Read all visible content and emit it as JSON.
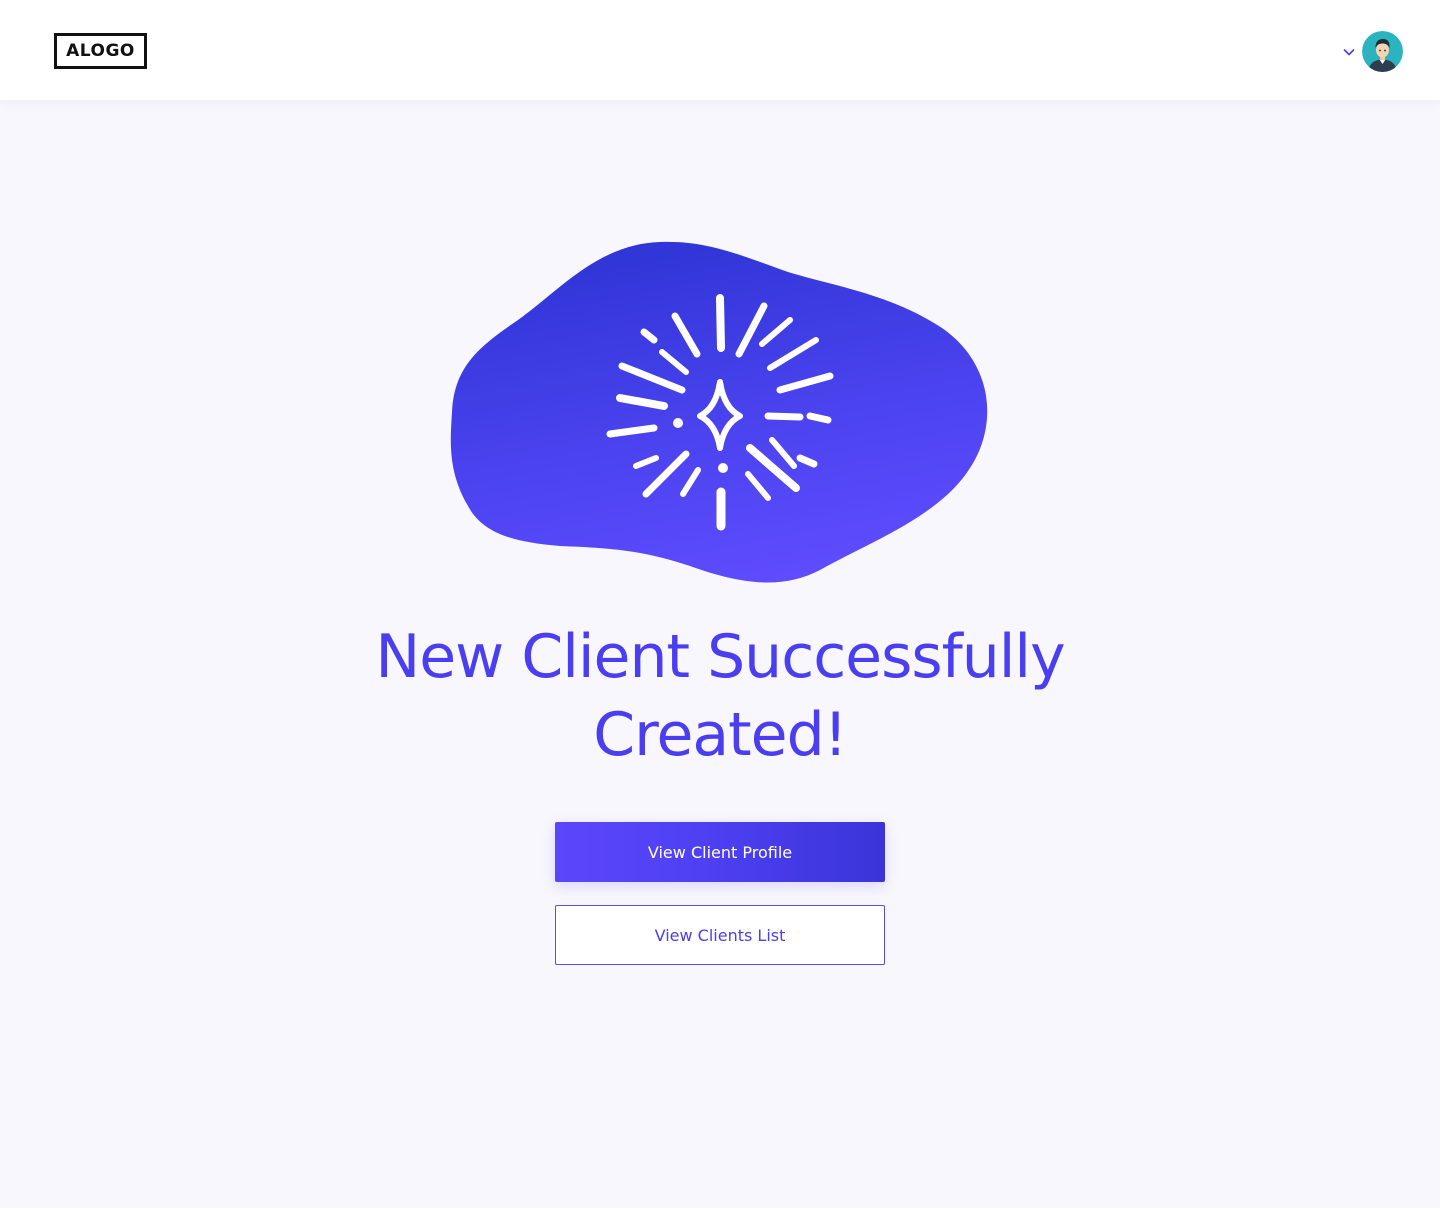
{
  "header": {
    "logo_text": "ALOGO",
    "chevron_icon": "chevron-down-icon",
    "avatar_icon": "user-avatar"
  },
  "hero": {
    "illustration_icon": "sparkle-burst-icon",
    "title_line1": "New Client Successfully",
    "title_line2": "Created!"
  },
  "actions": {
    "primary_label": "View Client Profile",
    "secondary_label": "View Clients List"
  },
  "colors": {
    "page_background": "#f8f7fd",
    "accent": "#4b3df0",
    "accent_dark": "#3535d8",
    "accent_light": "#5b47fb",
    "avatar_background": "#2bb3c0"
  }
}
